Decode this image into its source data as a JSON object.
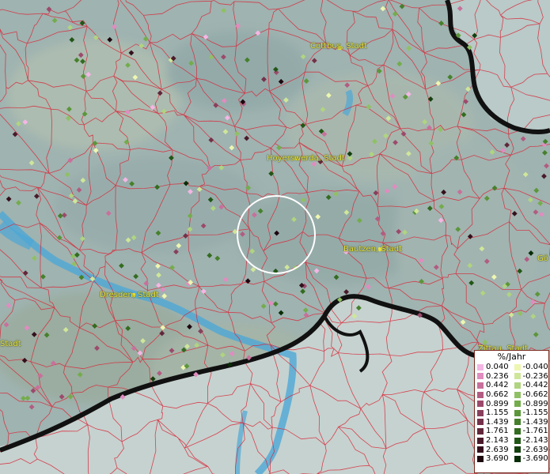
{
  "map": {
    "cities": [
      {
        "name": "Cottbus, Stadt"
      },
      {
        "name": "Hoyerswerda, Stadt"
      },
      {
        "name": "Bautzen, Stadt"
      },
      {
        "name": "Dresden, Stadt"
      },
      {
        "name": "Stadt"
      },
      {
        "name": "Gö"
      },
      {
        "name": "Zittau, Stadt"
      }
    ],
    "colors": {
      "water": "#4da7d6",
      "border": "#1a1a1a",
      "district_lines": "#d8283a",
      "label": "#e8e23a",
      "highlight_ring": "#ffffff"
    },
    "icons": [
      "measurement-point-icon",
      "selection-ring-icon"
    ]
  },
  "legend": {
    "title": "%/Jahr",
    "positive": [
      {
        "label": "0.040",
        "color": "#f4b6e4"
      },
      {
        "label": "0.236",
        "color": "#e08cc0"
      },
      {
        "label": "0.442",
        "color": "#c8709c"
      },
      {
        "label": "0.662",
        "color": "#b25c82"
      },
      {
        "label": "0.899",
        "color": "#9c4a6c"
      },
      {
        "label": "1.155",
        "color": "#88405c"
      },
      {
        "label": "1.439",
        "color": "#74314a"
      },
      {
        "label": "1.761",
        "color": "#60263a"
      },
      {
        "label": "2.143",
        "color": "#4a1a2a"
      },
      {
        "label": "2.639",
        "color": "#34101c"
      },
      {
        "label": "3.690",
        "color": "#1e060e"
      }
    ],
    "negative": [
      {
        "label": "-0.040",
        "color": "#eef6b0"
      },
      {
        "label": "-0.236",
        "color": "#cfe69a"
      },
      {
        "label": "-0.442",
        "color": "#b0d480"
      },
      {
        "label": "-0.662",
        "color": "#90c064"
      },
      {
        "label": "-0.899",
        "color": "#74ac4c"
      },
      {
        "label": "-1.155",
        "color": "#5c963a"
      },
      {
        "label": "-1.439",
        "color": "#46802c"
      },
      {
        "label": "-1.761",
        "color": "#336c20"
      },
      {
        "label": "-2.143",
        "color": "#225616"
      },
      {
        "label": "-2.639",
        "color": "#14400e"
      },
      {
        "label": "-3.690",
        "color": "#082c06"
      }
    ]
  }
}
